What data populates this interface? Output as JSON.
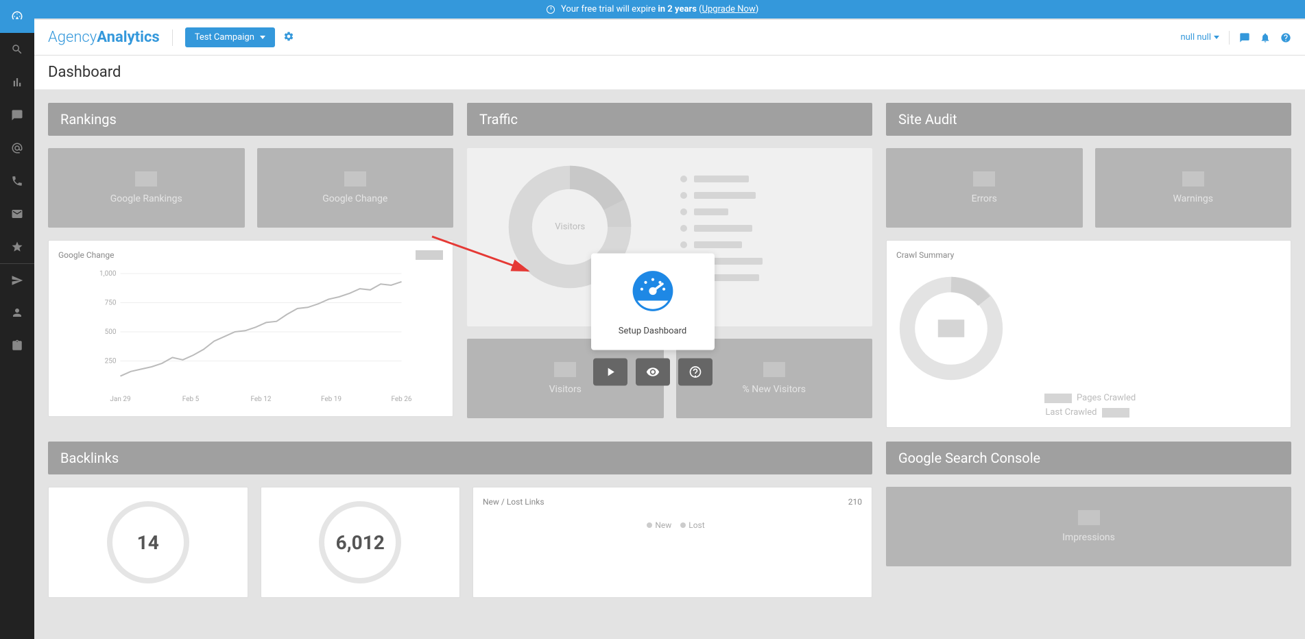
{
  "banner": {
    "prefix": "Your free trial will expire ",
    "bold": "in 2 years",
    "upgrade": "Upgrade Now"
  },
  "sidebar": {
    "items": [
      {
        "name": "dashboard",
        "icon": "gauge",
        "active": true
      },
      {
        "name": "search",
        "icon": "search"
      },
      {
        "name": "analytics",
        "icon": "bar-chart"
      },
      {
        "name": "messages",
        "icon": "comment"
      },
      {
        "name": "at",
        "icon": "at"
      },
      {
        "name": "phone",
        "icon": "phone"
      },
      {
        "name": "mail",
        "icon": "envelope"
      },
      {
        "name": "favorites",
        "icon": "star"
      },
      {
        "name": "send",
        "icon": "paper-plane"
      },
      {
        "name": "users",
        "icon": "user"
      },
      {
        "name": "tasks",
        "icon": "clipboard"
      }
    ]
  },
  "header": {
    "logo_a": "Agency",
    "logo_b": "Analytics",
    "campaign_label": "Test Campaign",
    "user_label": "null null"
  },
  "page_title": "Dashboard",
  "widgets": {
    "rankings": {
      "title": "Rankings",
      "tiles": [
        "Google Rankings",
        "Google Change"
      ],
      "chart_label": "Google Change"
    },
    "traffic": {
      "title": "Traffic",
      "donut_label": "Visitors",
      "tiles": [
        "Visitors",
        "% New Visitors"
      ]
    },
    "audit": {
      "title": "Site Audit",
      "tiles": [
        "Errors",
        "Warnings"
      ],
      "summary_label": "Crawl Summary",
      "pages_crawled_label": "Pages Crawled",
      "last_crawled_label": "Last Crawled"
    },
    "backlinks": {
      "title": "Backlinks",
      "circle1": "14",
      "circle2": "6,012",
      "links_label": "New / Lost Links",
      "links_count": "210",
      "legend_new": "New",
      "legend_lost": "Lost"
    },
    "gsc": {
      "title": "Google Search Console",
      "tile": "Impressions"
    }
  },
  "overlay": {
    "setup_label": "Setup Dashboard"
  },
  "chart_data": {
    "type": "line",
    "title": "Google Change",
    "xlabel": "",
    "ylabel": "",
    "ylim": [
      0,
      1000
    ],
    "x": [
      "Jan 29",
      "Feb 5",
      "Feb 12",
      "Feb 19",
      "Feb 26"
    ],
    "y_ticks": [
      250,
      500,
      750,
      1000
    ],
    "series": [
      {
        "name": "Google Change",
        "values": [
          120,
          160,
          180,
          200,
          230,
          280,
          260,
          300,
          350,
          420,
          460,
          500,
          510,
          540,
          580,
          590,
          650,
          700,
          710,
          740,
          780,
          800,
          830,
          870,
          860,
          910,
          900,
          930
        ]
      }
    ]
  }
}
